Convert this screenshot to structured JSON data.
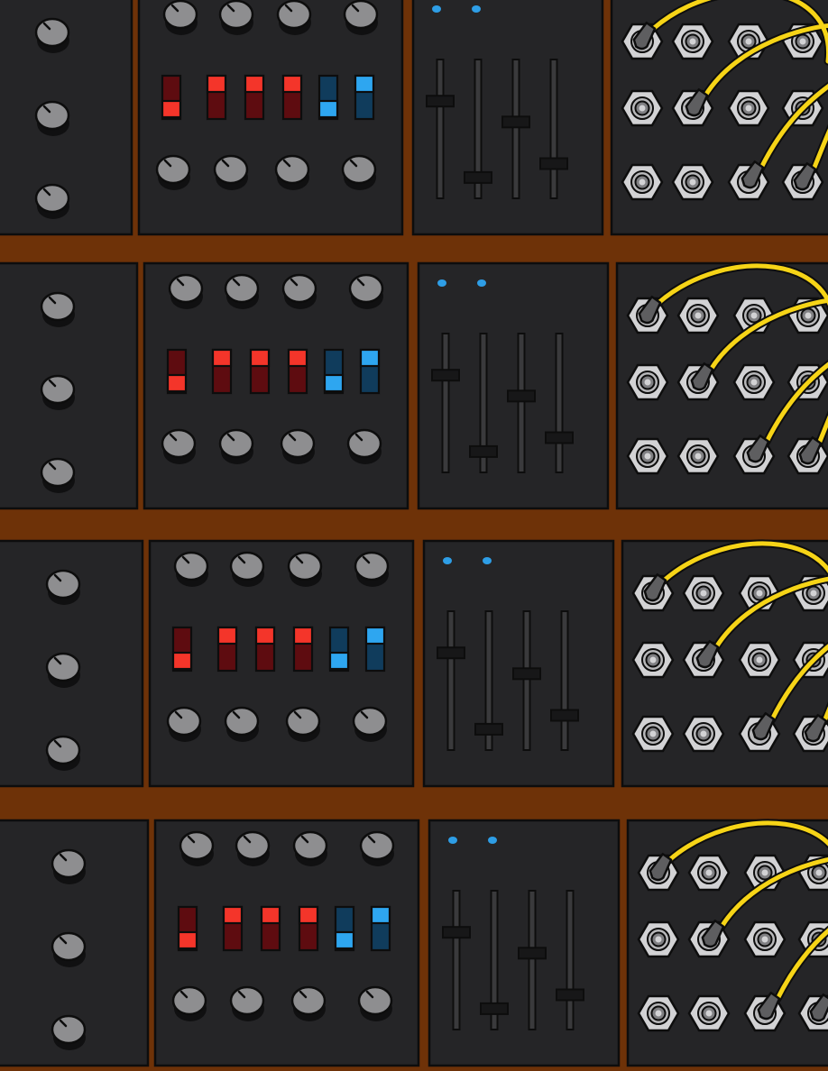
{
  "scene": "modular-synth-rack-illustration",
  "colors": {
    "rail": "#6e3208",
    "panel": "#252527",
    "outline": "#0d0d0d",
    "knob": "#8e8e90",
    "knob_shadow": "#101011",
    "switch_red": "#f4352a",
    "switch_red_dark": "#5e0c10",
    "switch_blue": "#2ea6f0",
    "switch_blue_dark": "#103c5c",
    "led": "#2e9ee6",
    "fader_track": "#3a3a3c",
    "fader_cap": "#171718",
    "jack_nut": "#d2d2d4",
    "jack_hole": "#7f7f82",
    "cable": "#f6d417",
    "plug": "#5e5e60"
  },
  "rows": [
    {
      "index": 0,
      "switches": [
        {
          "color": "red",
          "state": "down"
        },
        {
          "color": "red",
          "state": "up"
        },
        {
          "color": "red",
          "state": "up"
        },
        {
          "color": "red",
          "state": "up"
        },
        {
          "color": "blue",
          "state": "down"
        },
        {
          "color": "blue",
          "state": "up"
        }
      ],
      "fader_levels": [
        0.7,
        0.15,
        0.55,
        0.25
      ]
    },
    {
      "index": 1,
      "switches": [
        {
          "color": "red",
          "state": "down"
        },
        {
          "color": "red",
          "state": "up"
        },
        {
          "color": "red",
          "state": "up"
        },
        {
          "color": "red",
          "state": "up"
        },
        {
          "color": "blue",
          "state": "down"
        },
        {
          "color": "blue",
          "state": "up"
        }
      ],
      "fader_levels": [
        0.7,
        0.15,
        0.55,
        0.25
      ]
    },
    {
      "index": 2,
      "switches": [
        {
          "color": "red",
          "state": "down"
        },
        {
          "color": "red",
          "state": "up"
        },
        {
          "color": "red",
          "state": "up"
        },
        {
          "color": "red",
          "state": "up"
        },
        {
          "color": "blue",
          "state": "down"
        },
        {
          "color": "blue",
          "state": "up"
        }
      ],
      "fader_levels": [
        0.7,
        0.15,
        0.55,
        0.25
      ]
    },
    {
      "index": 3,
      "switches": [
        {
          "color": "red",
          "state": "down"
        },
        {
          "color": "red",
          "state": "up"
        },
        {
          "color": "red",
          "state": "up"
        },
        {
          "color": "red",
          "state": "up"
        },
        {
          "color": "blue",
          "state": "down"
        },
        {
          "color": "blue",
          "state": "up"
        }
      ],
      "fader_levels": [
        0.7,
        0.15,
        0.55,
        0.25
      ]
    }
  ]
}
